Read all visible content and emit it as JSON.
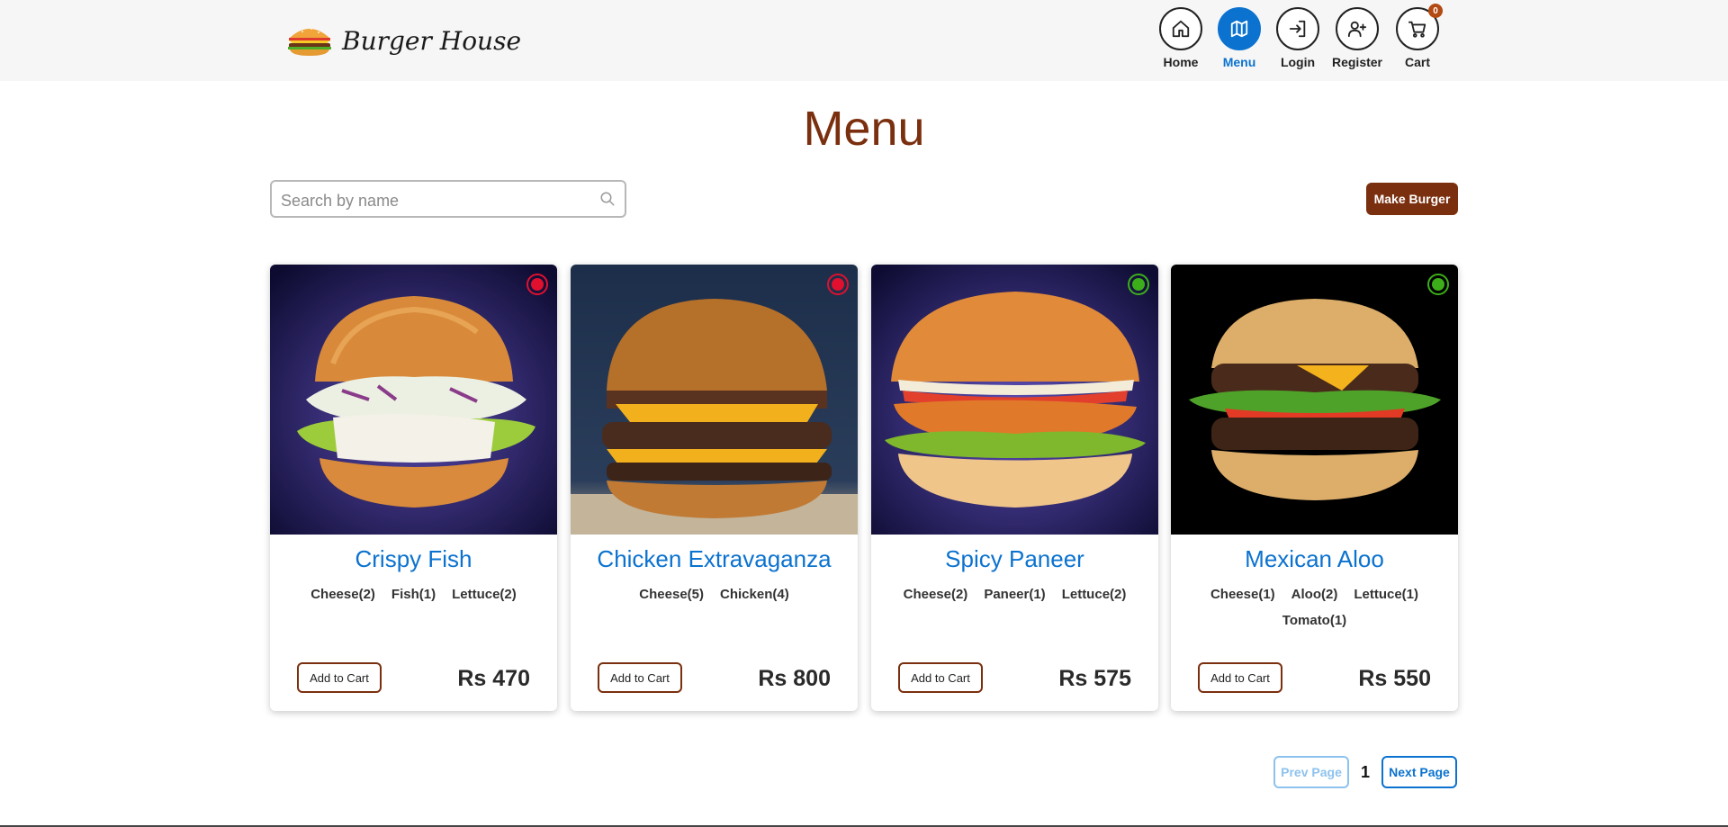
{
  "brand": {
    "name": "Burger House",
    "logo_icon": "burger-logo-icon"
  },
  "nav": {
    "items": [
      {
        "label": "Home",
        "icon": "home-icon",
        "active": false
      },
      {
        "label": "Menu",
        "icon": "map-icon",
        "active": true
      },
      {
        "label": "Login",
        "icon": "login-icon",
        "active": false
      },
      {
        "label": "Register",
        "icon": "user-plus-icon",
        "active": false
      },
      {
        "label": "Cart",
        "icon": "cart-icon",
        "active": false,
        "badge": "0"
      }
    ]
  },
  "page": {
    "title": "Menu"
  },
  "search": {
    "placeholder": "Search by name",
    "value": ""
  },
  "make_burger": {
    "label": "Make Burger"
  },
  "cards": [
    {
      "name": "Crispy Fish",
      "veg": false,
      "ingredients": [
        "Cheese(2)",
        "Fish(1)",
        "Lettuce(2)"
      ],
      "add_label": "Add to Cart",
      "price": "Rs 470"
    },
    {
      "name": "Chicken Extravaganza",
      "veg": false,
      "ingredients": [
        "Cheese(5)",
        "Chicken(4)"
      ],
      "add_label": "Add to Cart",
      "price": "Rs 800"
    },
    {
      "name": "Spicy Paneer",
      "veg": true,
      "ingredients": [
        "Cheese(2)",
        "Paneer(1)",
        "Lettuce(2)"
      ],
      "add_label": "Add to Cart",
      "price": "Rs 575"
    },
    {
      "name": "Mexican Aloo",
      "veg": true,
      "ingredients": [
        "Cheese(1)",
        "Aloo(2)",
        "Lettuce(1)",
        "Tomato(1)"
      ],
      "add_label": "Add to Cart",
      "price": "Rs 550"
    }
  ],
  "pagination": {
    "prev_label": "Prev Page",
    "current": "1",
    "next_label": "Next Page"
  },
  "colors": {
    "brand": "#7a2f0e",
    "accent": "#0b72cf",
    "nonveg": "#e0102e",
    "veg": "#3cae1a"
  }
}
